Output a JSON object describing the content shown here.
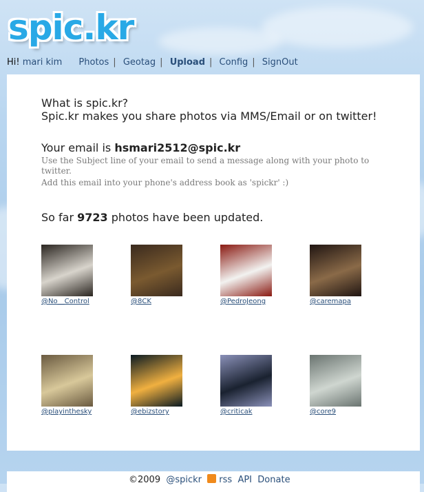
{
  "logo": {
    "text": "spic.kr"
  },
  "nav": {
    "greeting": "Hi!",
    "user": "mari kim",
    "items": [
      {
        "label": "Photos"
      },
      {
        "label": "Geotag"
      },
      {
        "label": "Upload"
      },
      {
        "label": "Config"
      },
      {
        "label": "SignOut"
      }
    ]
  },
  "intro": {
    "question": "What is spic.kr?",
    "answer": "Spic.kr makes you share photos via MMS/Email or on twitter!"
  },
  "email": {
    "prefix": "Your email is",
    "address": "hsmari2512@spic.kr",
    "help1": "Use the Subject line of your email to send a message along with your photo to twitter.",
    "help2": "Add this email into your phone's address book as 'spickr' :)"
  },
  "stats": {
    "prefix": "So far",
    "count": "9723",
    "suffix": "photos have been updated."
  },
  "photos": [
    {
      "user": "@No__Control",
      "colors": [
        "#2a2520",
        "#d8d4cc"
      ]
    },
    {
      "user": "@8CK",
      "colors": [
        "#3a2a1e",
        "#7a5a30"
      ]
    },
    {
      "user": "@PedroJeong",
      "colors": [
        "#8a1a12",
        "#f2f2f0"
      ]
    },
    {
      "user": "@caremapa",
      "colors": [
        "#201512",
        "#8a6a48"
      ]
    },
    {
      "user": "@playinthesky",
      "colors": [
        "#6a5a40",
        "#d8c89a"
      ]
    },
    {
      "user": "@ebizstory",
      "colors": [
        "#0a1a22",
        "#f0b040"
      ]
    },
    {
      "user": "@criticak",
      "colors": [
        "#8a90b8",
        "#1a2230"
      ]
    },
    {
      "user": "@core9",
      "colors": [
        "#6a7470",
        "#cfd6d0"
      ]
    }
  ],
  "footer": {
    "copyright": "©2009",
    "twitter": "@spickr",
    "rss": "rss",
    "api": "API",
    "donate": "Donate"
  }
}
